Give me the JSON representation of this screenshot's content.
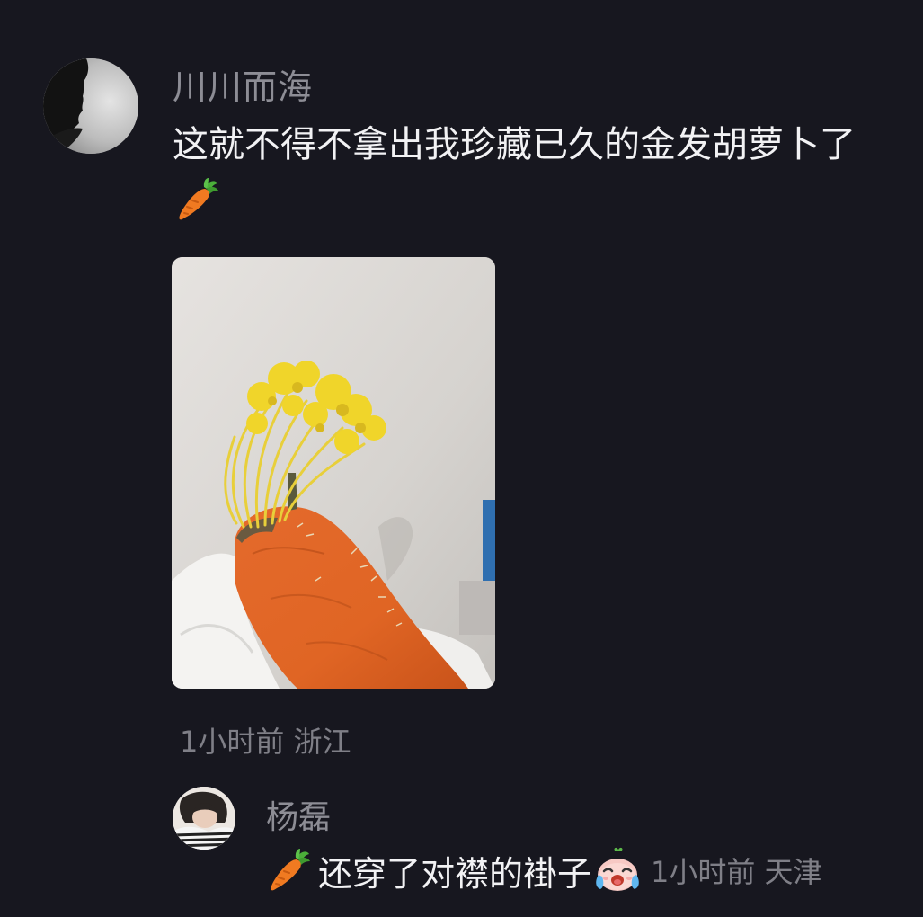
{
  "comment": {
    "username": "川川而海",
    "text": "这就不得不拿出我珍藏已久的金发胡萝卜了",
    "emoji": "carrot-emoji",
    "time": "1小时前",
    "location": "浙江",
    "meta": "1小时前 浙江"
  },
  "reply": {
    "username": "杨磊",
    "emoji_before": "carrot-emoji",
    "text": "还穿了对襟的褂子",
    "emoji_after": "crying-face-emoji",
    "time": "1小时前",
    "location": "天津",
    "meta": "1小时前 天津"
  },
  "colors": {
    "background": "#17171f",
    "username": "#8d8d95",
    "text": "#f2f2f4",
    "meta": "#7f7f87"
  }
}
